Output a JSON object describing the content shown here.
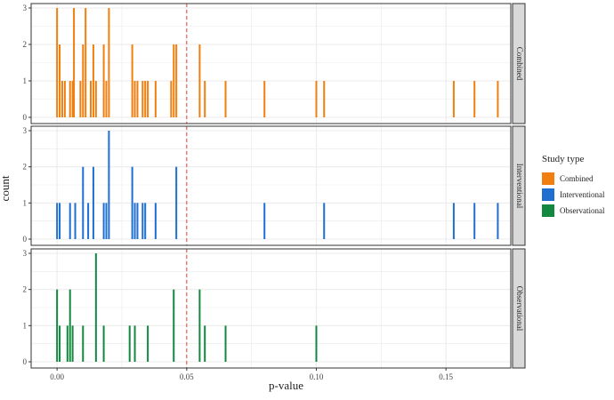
{
  "colors": {
    "combined": "#F07F0F",
    "interventional": "#1F6FD0",
    "observational": "#13893F",
    "panel_bg": "#EBEBEB",
    "strip_bg": "#D9D9D9",
    "refline": "#E4544E"
  },
  "chart_data": {
    "type": "bar",
    "xlabel": "p-value",
    "ylabel": "count",
    "xlim": [
      -0.01,
      0.175
    ],
    "ylim": [
      0,
      3
    ],
    "x_ticks": [
      0.0,
      0.05,
      0.1,
      0.15
    ],
    "x_tick_labels": [
      "0.00",
      "0.05",
      "0.10",
      "0.15"
    ],
    "y_ticks": [
      0,
      1,
      2,
      3
    ],
    "y_tick_labels": [
      "0",
      "1",
      "2",
      "3"
    ],
    "grid": true,
    "reference_line": {
      "x": 0.05,
      "style": "dashed"
    },
    "legend": {
      "title": "Study type",
      "position": "right",
      "entries": [
        "Combined",
        "Interventional",
        "Observational"
      ]
    },
    "panels": [
      {
        "strip_label": "Combined",
        "series_key": "combined",
        "bars": [
          {
            "x": 0.0,
            "y": 3
          },
          {
            "x": 0.001,
            "y": 2
          },
          {
            "x": 0.002,
            "y": 1
          },
          {
            "x": 0.003,
            "y": 1
          },
          {
            "x": 0.005,
            "y": 1
          },
          {
            "x": 0.006,
            "y": 1
          },
          {
            "x": 0.0065,
            "y": 3
          },
          {
            "x": 0.009,
            "y": 1
          },
          {
            "x": 0.01,
            "y": 2
          },
          {
            "x": 0.011,
            "y": 3
          },
          {
            "x": 0.013,
            "y": 1
          },
          {
            "x": 0.014,
            "y": 2
          },
          {
            "x": 0.015,
            "y": 1
          },
          {
            "x": 0.018,
            "y": 2
          },
          {
            "x": 0.019,
            "y": 1
          },
          {
            "x": 0.02,
            "y": 3
          },
          {
            "x": 0.029,
            "y": 2
          },
          {
            "x": 0.03,
            "y": 1
          },
          {
            "x": 0.031,
            "y": 1
          },
          {
            "x": 0.033,
            "y": 1
          },
          {
            "x": 0.034,
            "y": 1
          },
          {
            "x": 0.035,
            "y": 1
          },
          {
            "x": 0.038,
            "y": 1
          },
          {
            "x": 0.044,
            "y": 1
          },
          {
            "x": 0.045,
            "y": 2
          },
          {
            "x": 0.046,
            "y": 2
          },
          {
            "x": 0.055,
            "y": 2
          },
          {
            "x": 0.057,
            "y": 1
          },
          {
            "x": 0.065,
            "y": 1
          },
          {
            "x": 0.08,
            "y": 1
          },
          {
            "x": 0.1,
            "y": 1
          },
          {
            "x": 0.103,
            "y": 1
          },
          {
            "x": 0.153,
            "y": 1
          },
          {
            "x": 0.161,
            "y": 1
          },
          {
            "x": 0.17,
            "y": 1
          }
        ]
      },
      {
        "strip_label": "Interventional",
        "series_key": "interventional",
        "bars": [
          {
            "x": 0.0,
            "y": 1
          },
          {
            "x": 0.001,
            "y": 1
          },
          {
            "x": 0.005,
            "y": 1
          },
          {
            "x": 0.007,
            "y": 1
          },
          {
            "x": 0.01,
            "y": 2
          },
          {
            "x": 0.012,
            "y": 1
          },
          {
            "x": 0.014,
            "y": 2
          },
          {
            "x": 0.018,
            "y": 1
          },
          {
            "x": 0.019,
            "y": 1
          },
          {
            "x": 0.02,
            "y": 3
          },
          {
            "x": 0.029,
            "y": 2
          },
          {
            "x": 0.03,
            "y": 1
          },
          {
            "x": 0.031,
            "y": 1
          },
          {
            "x": 0.033,
            "y": 1
          },
          {
            "x": 0.034,
            "y": 1
          },
          {
            "x": 0.038,
            "y": 1
          },
          {
            "x": 0.046,
            "y": 2
          },
          {
            "x": 0.08,
            "y": 1
          },
          {
            "x": 0.103,
            "y": 1
          },
          {
            "x": 0.153,
            "y": 1
          },
          {
            "x": 0.161,
            "y": 1
          },
          {
            "x": 0.17,
            "y": 1
          }
        ]
      },
      {
        "strip_label": "Observational",
        "series_key": "observational",
        "bars": [
          {
            "x": 0.0,
            "y": 2
          },
          {
            "x": 0.001,
            "y": 1
          },
          {
            "x": 0.004,
            "y": 1
          },
          {
            "x": 0.005,
            "y": 2
          },
          {
            "x": 0.006,
            "y": 1
          },
          {
            "x": 0.01,
            "y": 1
          },
          {
            "x": 0.015,
            "y": 3
          },
          {
            "x": 0.018,
            "y": 1
          },
          {
            "x": 0.028,
            "y": 1
          },
          {
            "x": 0.03,
            "y": 1
          },
          {
            "x": 0.035,
            "y": 1
          },
          {
            "x": 0.045,
            "y": 2
          },
          {
            "x": 0.055,
            "y": 2
          },
          {
            "x": 0.057,
            "y": 1
          },
          {
            "x": 0.065,
            "y": 1
          },
          {
            "x": 0.1,
            "y": 1
          }
        ]
      }
    ]
  }
}
